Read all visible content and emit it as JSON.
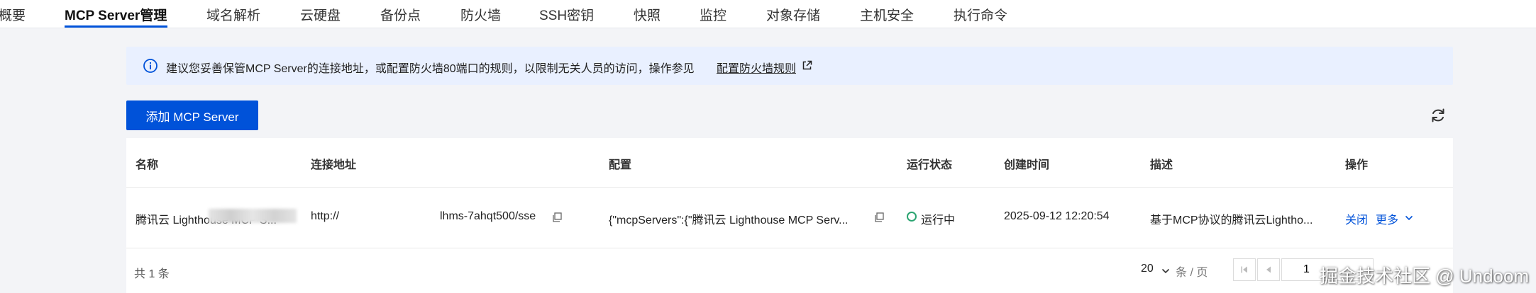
{
  "tabs": [
    {
      "label": "概要",
      "active": false
    },
    {
      "label": "MCP Server管理",
      "active": true
    },
    {
      "label": "域名解析",
      "active": false
    },
    {
      "label": "云硬盘",
      "active": false
    },
    {
      "label": "备份点",
      "active": false
    },
    {
      "label": "防火墙",
      "active": false
    },
    {
      "label": "SSH密钥",
      "active": false
    },
    {
      "label": "快照",
      "active": false
    },
    {
      "label": "监控",
      "active": false
    },
    {
      "label": "对象存储",
      "active": false
    },
    {
      "label": "主机安全",
      "active": false
    },
    {
      "label": "执行命令",
      "active": false
    }
  ],
  "notice": {
    "text": "建议您妥善保管MCP Server的连接地址，或配置防火墙80端口的规则，以限制无关人员的访问，操作参见",
    "link": "配置防火墙规则"
  },
  "toolbar": {
    "add_label": "添加 MCP Server"
  },
  "table": {
    "columns": [
      "名称",
      "连接地址",
      "配置",
      "运行状态",
      "创建时间",
      "描述",
      "操作"
    ],
    "rows": [
      {
        "name": "腾讯云 Lighthouse MCP S...",
        "address_prefix": "http://",
        "address_suffix": "lhms-7ahqt500/sse",
        "config": "{\"mcpServers\":{\"腾讯云 Lighthouse MCP Serv...",
        "status": "运行中",
        "created": "2025-09-12 12:20:54",
        "description": "基于MCP协议的腾讯云Lightho...",
        "action_close": "关闭",
        "action_more": "更多"
      }
    ]
  },
  "pagination": {
    "total": "共 1 条",
    "page_size": "20",
    "per_page": "条 / 页",
    "page": "1"
  },
  "watermark": "掘金技术社区 @ Undoom",
  "colors": {
    "primary": "#0052d9",
    "success": "#2ba471",
    "notice_bg": "#e9f0ff"
  }
}
